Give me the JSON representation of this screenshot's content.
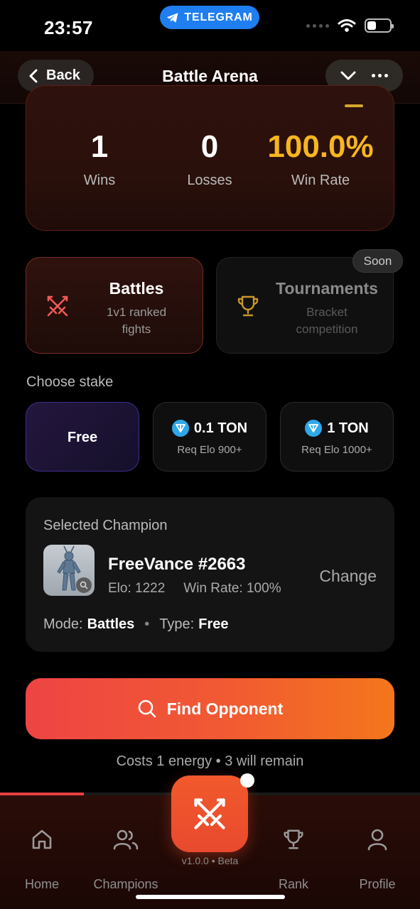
{
  "status_bar": {
    "time": "23:57",
    "app_badge": "TELEGRAM"
  },
  "header": {
    "back_label": "Back",
    "title": "Battle Arena"
  },
  "stats": {
    "wins_value": "1",
    "wins_label": "Wins",
    "losses_value": "0",
    "losses_label": "Losses",
    "winrate_value": "100.0%",
    "winrate_label": "Win Rate"
  },
  "modes": {
    "battles": {
      "name": "Battles",
      "sub": "1v1 ranked fights"
    },
    "tournaments": {
      "name": "Tournaments",
      "sub": "Bracket competition",
      "badge": "Soon"
    }
  },
  "stake": {
    "heading": "Choose stake",
    "free_label": "Free",
    "options": [
      {
        "amount": "0.1 TON",
        "req": "Req Elo 900+"
      },
      {
        "amount": "1 TON",
        "req": "Req Elo 1000+"
      }
    ]
  },
  "champion": {
    "heading": "Selected Champion",
    "name": "FreeVance #2663",
    "elo": "Elo: 1222",
    "win_rate": "Win Rate: 100%",
    "change_label": "Change",
    "mode_label": "Mode:",
    "mode_value": "Battles",
    "type_label": "Type:",
    "type_value": "Free"
  },
  "find": {
    "label": "Find Opponent",
    "cost_text": "Costs 1 energy • 3 will remain"
  },
  "progress": 0.2,
  "nav": {
    "items": [
      {
        "label": "Home",
        "icon": "home-icon"
      },
      {
        "label": "Champions",
        "icon": "users-icon"
      },
      {
        "label": "Rank",
        "icon": "trophy-icon"
      },
      {
        "label": "Profile",
        "icon": "user-icon"
      }
    ],
    "center_icon": "swords-icon",
    "version": "v1.0.0 • Beta"
  },
  "colors": {
    "accent": "#f15a32",
    "gold": "#f6b61f",
    "ton_blue": "#2fa8ea",
    "telegram_blue": "#1f7ef0"
  }
}
